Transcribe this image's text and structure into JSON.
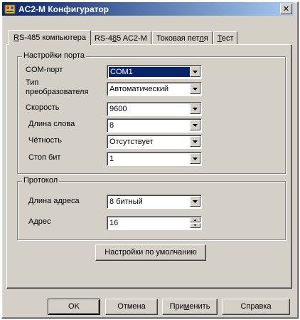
{
  "window": {
    "title": "AC2-M Конфигуратор",
    "close_glyph": "✕"
  },
  "tabs": [
    {
      "pre": "",
      "accel": "R",
      "post": "S-485 компьютера",
      "active": true
    },
    {
      "pre": "RS-4",
      "accel": "8",
      "post": "5 AC2-M",
      "active": false
    },
    {
      "pre": "Токовая пет",
      "accel": "л",
      "post": "я",
      "active": false
    },
    {
      "pre": "",
      "accel": "Т",
      "post": "ест",
      "active": false
    }
  ],
  "port_group": {
    "title": "Настройки порта",
    "fields": [
      {
        "label": "COM-порт",
        "value": "COM1"
      },
      {
        "label": "Тип\nпреобразователя",
        "value": "Автоматический"
      },
      {
        "label": "Скорость",
        "value": "9600"
      },
      {
        "label": "Длина слова",
        "value": "8"
      },
      {
        "label": "Чётность",
        "value": "Отсутствует"
      },
      {
        "label": "Стоп бит",
        "value": "1"
      }
    ]
  },
  "protocol_group": {
    "title": "Протокол",
    "address_length": {
      "label": "Длина адреса",
      "value": "8 битный"
    },
    "address": {
      "label": "Адрес",
      "value": "16"
    }
  },
  "defaults_button": "Настройки по умолчанию",
  "footer": {
    "ok": "OK",
    "cancel": "Отмена",
    "apply": {
      "pre": "При",
      "accel": "м",
      "post": "енить"
    },
    "help": "Справка"
  },
  "colors": {
    "titlebar_start": "#0a246a",
    "titlebar_end": "#a6caf0",
    "face": "#d4d0c8",
    "selection": "#0a246a"
  }
}
